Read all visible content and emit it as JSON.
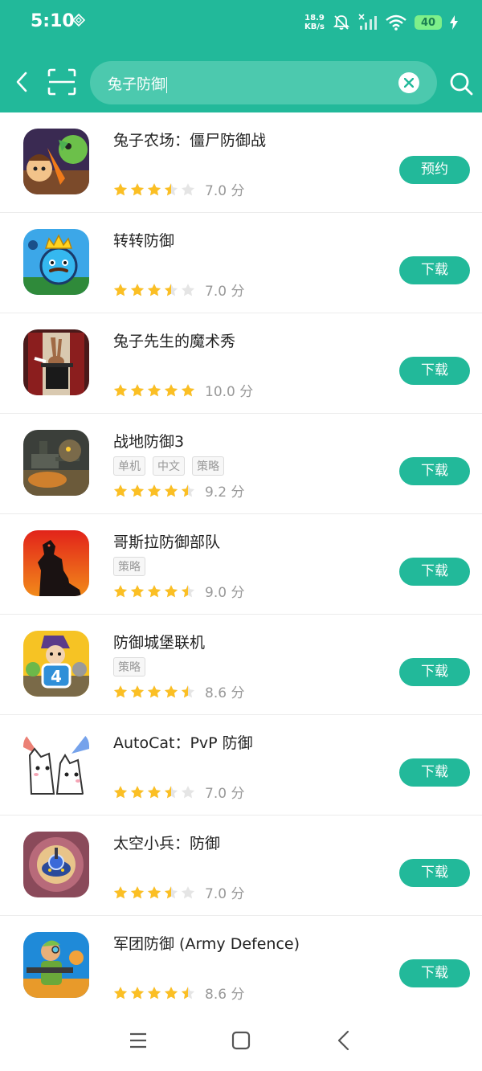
{
  "status_bar": {
    "time": "5:10",
    "net_speed_value": "18.9",
    "net_speed_unit": "KB/s",
    "battery": "40"
  },
  "search": {
    "query": "兔子防御"
  },
  "colors": {
    "accent": "#22b99a",
    "star_filled": "#fbbf24",
    "star_empty": "#e5e5e5"
  },
  "results": [
    {
      "name": "兔子农场：僵尸防御战",
      "tags": [],
      "stars": 3.5,
      "score": "7.0 分",
      "action": "预约"
    },
    {
      "name": "转转防御",
      "tags": [],
      "stars": 3.5,
      "score": "7.0 分",
      "action": "下载"
    },
    {
      "name": "兔子先生的魔术秀",
      "tags": [],
      "stars": 5,
      "score": "10.0 分",
      "action": "下载"
    },
    {
      "name": "战地防御3",
      "tags": [
        "单机",
        "中文",
        "策略"
      ],
      "stars": 4.5,
      "score": "9.2 分",
      "action": "下载"
    },
    {
      "name": "哥斯拉防御部队",
      "tags": [
        "策略"
      ],
      "stars": 4.5,
      "score": "9.0 分",
      "action": "下载"
    },
    {
      "name": "防御城堡联机",
      "tags": [
        "策略"
      ],
      "stars": 4.5,
      "score": "8.6 分",
      "action": "下载"
    },
    {
      "name": "AutoCat：PvP 防御",
      "tags": [],
      "stars": 3.5,
      "score": "7.0 分",
      "action": "下载"
    },
    {
      "name": "太空小兵：防御",
      "tags": [],
      "stars": 3.5,
      "score": "7.0 分",
      "action": "下载"
    },
    {
      "name": "军团防御 (Army Defence)",
      "tags": [],
      "stars": 4.5,
      "score": "8.6 分",
      "action": "下载"
    }
  ]
}
